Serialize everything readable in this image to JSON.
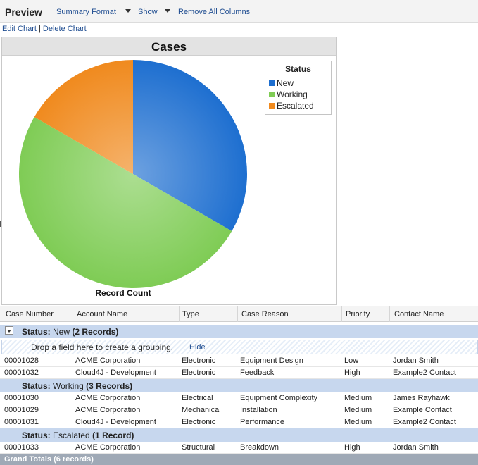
{
  "toolbar": {
    "title": "Preview",
    "summary_format": "Summary Format",
    "show": "Show",
    "remove_all_columns": "Remove All Columns"
  },
  "chart_actions": {
    "edit": "Edit Chart",
    "separator": "|",
    "delete": "Delete Chart"
  },
  "chart_data": {
    "type": "pie",
    "title": "Cases",
    "xlabel": "Record Count",
    "legend_title": "Status",
    "legend_position": "top-right",
    "categories": [
      "New",
      "Working",
      "Escalated"
    ],
    "values": [
      2,
      3,
      1
    ],
    "colors": [
      "#1e6fd0",
      "#7fcc55",
      "#f08a1e"
    ]
  },
  "table": {
    "columns": [
      "Case Number",
      "Account Name",
      "Type",
      "Case Reason",
      "Priority",
      "Contact Name"
    ],
    "drop_hint": "Drop a field here to create a grouping.",
    "hide_label": "Hide",
    "groups": [
      {
        "label": "Status:",
        "value": "New",
        "count": "(2 Records)",
        "rows": [
          [
            "00001028",
            "ACME Corporation",
            "Electronic",
            "Equipment Design",
            "Low",
            "Jordan Smith"
          ],
          [
            "00001032",
            "Cloud4J - Development",
            "Electronic",
            "Feedback",
            "High",
            "Example2 Contact"
          ]
        ]
      },
      {
        "label": "Status:",
        "value": "Working",
        "count": "(3 Records)",
        "rows": [
          [
            "00001030",
            "ACME Corporation",
            "Electrical",
            "Equipment Complexity",
            "Medium",
            "James Rayhawk"
          ],
          [
            "00001029",
            "ACME Corporation",
            "Mechanical",
            "Installation",
            "Medium",
            "Example Contact"
          ],
          [
            "00001031",
            "Cloud4J - Development",
            "Electronic",
            "Performance",
            "Medium",
            "Example2 Contact"
          ]
        ]
      },
      {
        "label": "Status:",
        "value": "Escalated",
        "count": "(1 Record)",
        "rows": [
          [
            "00001033",
            "ACME Corporation",
            "Structural",
            "Breakdown",
            "High",
            "Jordan Smith"
          ]
        ]
      }
    ],
    "grand_totals": "Grand Totals (6 records)"
  }
}
